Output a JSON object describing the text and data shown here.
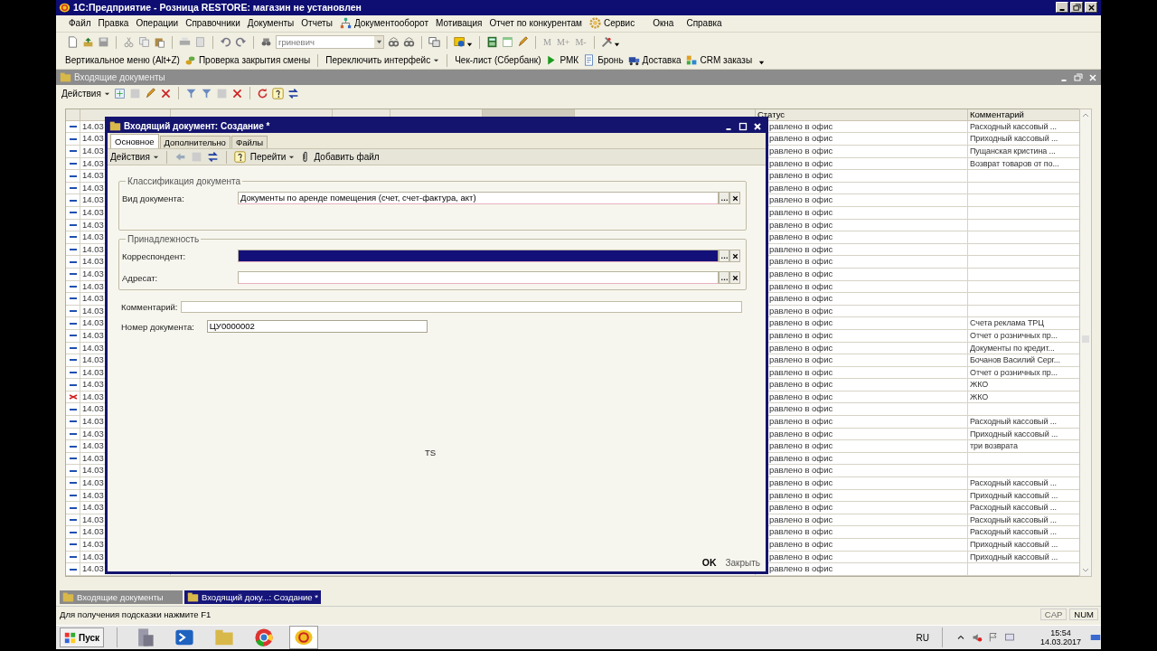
{
  "window": {
    "title": "1С:Предприятие - Розница RESTORE: магазин не установлен"
  },
  "menu": [
    "Файл",
    "Правка",
    "Операции",
    "Справочники",
    "Документы",
    "Отчеты",
    "Документооборот",
    "Мотивация",
    "Отчет по конкурентам",
    "Сервис",
    "Окна",
    "Справка"
  ],
  "toolbar": {
    "search_value": "гриневич",
    "memory_buttons": [
      "M",
      "M+",
      "M-"
    ]
  },
  "quick_bar": [
    {
      "label": "Вертикальное меню (Alt+Z)",
      "dropdown": false
    },
    {
      "label": "Проверка закрытия смены",
      "dropdown": false
    },
    {
      "label": "Переключить интерфейс",
      "dropdown": true
    },
    {
      "label": "Чек-лист (Сбербанк)",
      "dropdown": false
    },
    {
      "label": "РМК",
      "dropdown": false
    },
    {
      "label": "Бронь",
      "dropdown": false
    },
    {
      "label": "Доставка",
      "dropdown": false
    },
    {
      "label": "CRM заказы",
      "dropdown": false
    }
  ],
  "list_window": {
    "title": "Входящие документы",
    "actions_label": "Действия",
    "columns": [
      {
        "sorted": false
      },
      {
        "sorted": false
      },
      {
        "sorted": false
      },
      {
        "sorted": false
      },
      {
        "sorted": true
      },
      {
        "sorted": false
      },
      {
        "label": "Статус",
        "sorted": false
      },
      {
        "label": "Комментарий",
        "sorted": false
      }
    ],
    "rows": [
      {
        "kind": "dash",
        "date": "14.03",
        "status": "равлено в офис",
        "comment": "Расходный кассовый ..."
      },
      {
        "kind": "dash",
        "date": "14.03",
        "status": "равлено в офис",
        "comment": "Приходный кассовый ..."
      },
      {
        "kind": "dash",
        "date": "14.03",
        "status": "равлено в офис",
        "comment": "Пущанская кристина ..."
      },
      {
        "kind": "dash",
        "date": "14.03",
        "status": "равлено в офис",
        "comment": "Возврат товаров от по..."
      },
      {
        "kind": "dash",
        "date": "14.03",
        "status": "равлено в офис"
      },
      {
        "kind": "dash",
        "date": "14.03",
        "status": "равлено в офис"
      },
      {
        "kind": "dash",
        "date": "14.03",
        "status": "равлено в офис"
      },
      {
        "kind": "dash",
        "date": "14.03",
        "status": "равлено в офис"
      },
      {
        "kind": "dash",
        "date": "14.03",
        "status": "равлено в офис"
      },
      {
        "kind": "dash",
        "date": "14.03",
        "status": "равлено в офис"
      },
      {
        "kind": "dash",
        "date": "14.03",
        "status": "равлено в офис"
      },
      {
        "kind": "dash",
        "date": "14.03",
        "status": "равлено в офис"
      },
      {
        "kind": "dash",
        "date": "14.03",
        "status": "равлено в офис"
      },
      {
        "kind": "dash",
        "date": "14.03",
        "status": "равлено в офис"
      },
      {
        "kind": "dash",
        "date": "14.03",
        "status": "равлено в офис"
      },
      {
        "kind": "dash",
        "date": "14.03",
        "status": "равлено в офис"
      },
      {
        "kind": "dash",
        "date": "14.03",
        "status": "равлено в офис",
        "comment": "Счета реклама ТРЦ"
      },
      {
        "kind": "dash",
        "date": "14.03",
        "status": "равлено в офис",
        "comment": "Отчет о розничных пр..."
      },
      {
        "kind": "dash",
        "date": "14.03",
        "status": "равлено в офис",
        "comment": "Документы по кредит..."
      },
      {
        "kind": "dash",
        "date": "14.03",
        "status": "равлено в офис",
        "comment": "Бочанов Василий Серг..."
      },
      {
        "kind": "dash",
        "date": "14.03",
        "status": "равлено в офис",
        "comment": "Отчет о розничных пр..."
      },
      {
        "kind": "dash",
        "date": "14.03",
        "status": "равлено в офис",
        "comment": "ЖКО"
      },
      {
        "kind": "crossed",
        "date": "14.03",
        "status": "равлено в офис",
        "comment": "ЖКО"
      },
      {
        "kind": "dash",
        "date": "14.03",
        "status": "равлено в офис"
      },
      {
        "kind": "dash",
        "date": "14.03",
        "status": "равлено в офис",
        "comment": "Расходный кассовый ..."
      },
      {
        "kind": "dash",
        "date": "14.03",
        "status": "равлено в офис",
        "comment": "Приходный кассовый ..."
      },
      {
        "kind": "dash",
        "date": "14.03",
        "status": "равлено в офис",
        "comment": "три возврата"
      },
      {
        "kind": "dash",
        "date": "14.03",
        "status": "равлено в офис"
      },
      {
        "kind": "dash",
        "date": "14.03",
        "status": "равлено в офис"
      },
      {
        "kind": "dash",
        "date": "14.03",
        "status": "равлено в офис",
        "comment": "Расходный кассовый ..."
      },
      {
        "kind": "dash",
        "date": "14.03",
        "status": "равлено в офис",
        "comment": "Приходный кассовый ..."
      },
      {
        "kind": "dash",
        "date": "14.03",
        "status": "равлено в офис",
        "comment": "Расходный кассовый ..."
      },
      {
        "kind": "dash",
        "date": "14.03",
        "status": "равлено в офис",
        "comment": "Расходный кассовый ..."
      },
      {
        "kind": "dash",
        "date": "14.03",
        "status": "равлено в офис",
        "comment": "Расходный кассовый ..."
      },
      {
        "kind": "dash",
        "date": "14.03",
        "status": "равлено в офис",
        "comment": "Приходный кассовый ..."
      },
      {
        "kind": "dash",
        "date": "14.03",
        "status": "равлено в офис",
        "comment": "Приходный кассовый ..."
      },
      {
        "kind": "dash",
        "date": "14.03",
        "status": "равлено в офис"
      }
    ]
  },
  "dialog": {
    "title": "Входящий документ: Создание *",
    "tabs": [
      {
        "label": "Основное",
        "selected": true
      },
      {
        "label": "Дополнительно",
        "selected": false
      },
      {
        "label": "Файлы",
        "selected": false
      }
    ],
    "actions_label": "Действия",
    "goto_label": "Перейти",
    "add_file_label": "Добавить файл",
    "groups": [
      {
        "title": "Классификация документа",
        "fields": [
          {
            "label": "Вид документа:",
            "value": "Документы по аренде помещения (счет, счет-фактура, акт)",
            "focused": false
          }
        ]
      },
      {
        "title": "Принадлежность",
        "fields": [
          {
            "label": "Корреспондент:",
            "focused": true
          },
          {
            "label": "Адресат:",
            "focused": false
          }
        ]
      }
    ],
    "comment_label": "Комментарий:",
    "number_label": "Номер документа:",
    "number_value": "ЦУ0000002",
    "center_text": "TS",
    "ok_label": "OK",
    "close_label": "Закрыть"
  },
  "window_list": [
    {
      "label": "Входящие документы",
      "selected": false
    },
    {
      "label": "Входящий доку...: Создание *",
      "selected": true
    }
  ],
  "status_bar": {
    "hint": "Для получения подсказки нажмите F1",
    "indicators": [
      "CAP",
      "NUM"
    ]
  },
  "taskbar": {
    "start_label": "Пуск",
    "apps": [
      {
        "selected": false
      },
      {
        "selected": false
      },
      {
        "selected": false
      },
      {
        "selected": false
      },
      {
        "selected": true
      }
    ],
    "language": "RU",
    "time": "15:54",
    "date": "14.03.2017"
  }
}
